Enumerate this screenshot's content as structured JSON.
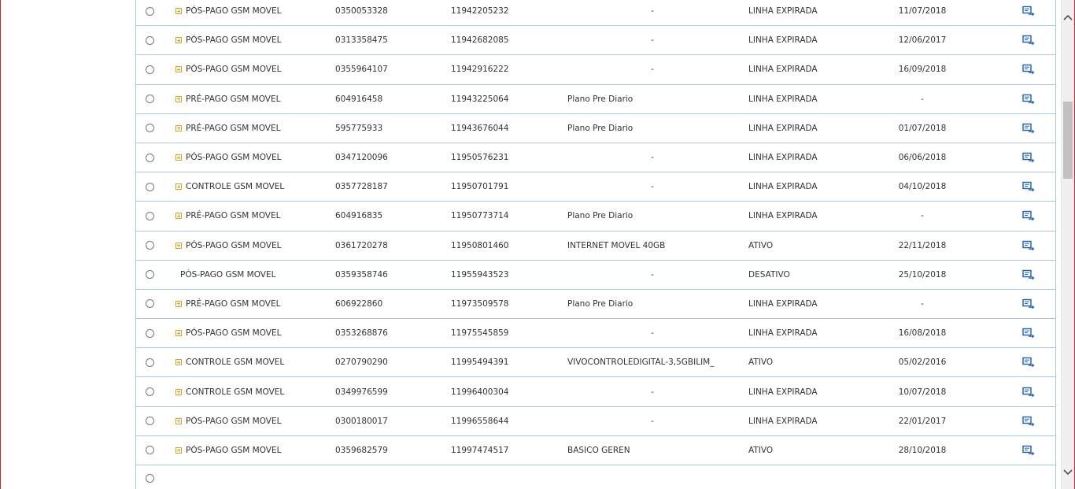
{
  "colors": {
    "accent_border": "#a9c6de",
    "window_frame": "#e3202a",
    "expand_icon": "#d9a521",
    "action_icon": "#1f5ea8"
  },
  "icons": {
    "expand": "plus-square-icon",
    "action": "edit-forward-icon",
    "scroll_up": "chevron-up-icon",
    "scroll_down": "chevron-down-icon"
  },
  "table": {
    "rows": [
      {
        "type": "PÓS-PAGO GSM MOVEL",
        "account": "0350053328",
        "line": "11942205232",
        "plan": "-",
        "status": "LINHA EXPIRADA",
        "date": "11/07/2018",
        "expandable": true
      },
      {
        "type": "PÓS-PAGO GSM MOVEL",
        "account": "0313358475",
        "line": "11942682085",
        "plan": "-",
        "status": "LINHA EXPIRADA",
        "date": "12/06/2017",
        "expandable": true
      },
      {
        "type": "PÓS-PAGO GSM MOVEL",
        "account": "0355964107",
        "line": "11942916222",
        "plan": "-",
        "status": "LINHA EXPIRADA",
        "date": "16/09/2018",
        "expandable": true
      },
      {
        "type": "PRÉ-PAGO GSM MOVEL",
        "account": "604916458",
        "line": "11943225064",
        "plan": "Plano Pre Diario",
        "status": "LINHA EXPIRADA",
        "date": "-",
        "expandable": true
      },
      {
        "type": "PRÉ-PAGO GSM MOVEL",
        "account": "595775933",
        "line": "11943676044",
        "plan": "Plano Pre Diario",
        "status": "LINHA EXPIRADA",
        "date": "01/07/2018",
        "expandable": true
      },
      {
        "type": "PÓS-PAGO GSM MOVEL",
        "account": "0347120096",
        "line": "11950576231",
        "plan": "-",
        "status": "LINHA EXPIRADA",
        "date": "06/06/2018",
        "expandable": true
      },
      {
        "type": "CONTROLE GSM MOVEL",
        "account": "0357728187",
        "line": "11950701791",
        "plan": "-",
        "status": "LINHA EXPIRADA",
        "date": "04/10/2018",
        "expandable": true
      },
      {
        "type": "PRÉ-PAGO GSM MOVEL",
        "account": "604916835",
        "line": "11950773714",
        "plan": "Plano Pre Diario",
        "status": "LINHA EXPIRADA",
        "date": "-",
        "expandable": true
      },
      {
        "type": "PÓS-PAGO GSM MOVEL",
        "account": "0361720278",
        "line": "11950801460",
        "plan": "INTERNET MOVEL 40GB",
        "status": "ATIVO",
        "date": "22/11/2018",
        "expandable": true
      },
      {
        "type": "PÓS-PAGO GSM MOVEL",
        "account": "0359358746",
        "line": "11955943523",
        "plan": "-",
        "status": "DESATIVO",
        "date": "25/10/2018",
        "expandable": false
      },
      {
        "type": "PRÉ-PAGO GSM MOVEL",
        "account": "606922860",
        "line": "11973509578",
        "plan": "Plano Pre Diario",
        "status": "LINHA EXPIRADA",
        "date": "-",
        "expandable": true
      },
      {
        "type": "PÓS-PAGO GSM MOVEL",
        "account": "0353268876",
        "line": "11975545859",
        "plan": "-",
        "status": "LINHA EXPIRADA",
        "date": "16/08/2018",
        "expandable": true
      },
      {
        "type": "CONTROLE GSM MOVEL",
        "account": "0270790290",
        "line": "11995494391",
        "plan": "VIVOCONTROLEDIGITAL-3,5GBILIM_",
        "status": "ATIVO",
        "date": "05/02/2016",
        "expandable": true
      },
      {
        "type": "CONTROLE GSM MOVEL",
        "account": "0349976599",
        "line": "11996400304",
        "plan": "-",
        "status": "LINHA EXPIRADA",
        "date": "10/07/2018",
        "expandable": true
      },
      {
        "type": "PÓS-PAGO GSM MOVEL",
        "account": "0300180017",
        "line": "11996558644",
        "plan": "-",
        "status": "LINHA EXPIRADA",
        "date": "22/01/2017",
        "expandable": true
      },
      {
        "type": "PÓS-PAGO GSM MOVEL",
        "account": "0359682579",
        "line": "11997474517",
        "plan": "BASICO GEREN",
        "status": "ATIVO",
        "date": "28/10/2018",
        "expandable": true
      }
    ]
  }
}
